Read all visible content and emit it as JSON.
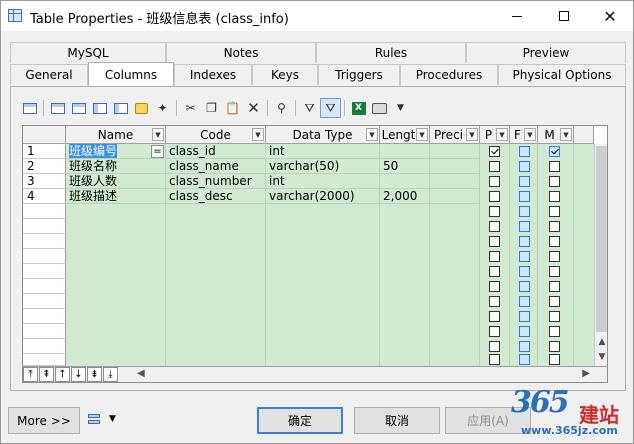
{
  "window": {
    "title": "Table Properties - 班级信息表 (class_info)"
  },
  "tabs_row_1": [
    {
      "label": "MySQL"
    },
    {
      "label": "Notes"
    },
    {
      "label": "Rules"
    },
    {
      "label": "Preview"
    }
  ],
  "tabs_row_2": [
    {
      "label": "General"
    },
    {
      "label": "Columns"
    },
    {
      "label": "Indexes"
    },
    {
      "label": "Keys"
    },
    {
      "label": "Triggers"
    },
    {
      "label": "Procedures"
    },
    {
      "label": "Physical Options"
    }
  ],
  "grid": {
    "headers": [
      "Name",
      "Code",
      "Data Type",
      "Lengt",
      "Preci",
      "P",
      "F",
      "M"
    ],
    "rows": [
      {
        "num": "1",
        "name": "班级编号",
        "code": "class_id",
        "type": "int",
        "length": "",
        "p": true,
        "m": true
      },
      {
        "num": "2",
        "name": "班级名称",
        "code": "class_name",
        "type": "varchar(50)",
        "length": "50",
        "p": false,
        "m": false
      },
      {
        "num": "3",
        "name": "班级人数",
        "code": "class_number",
        "type": "int",
        "length": "",
        "p": false,
        "m": false
      },
      {
        "num": "4",
        "name": "班级描述",
        "code": "class_desc",
        "type": "varchar(2000)",
        "length": "2,000",
        "p": false,
        "m": false
      }
    ],
    "edit_button": "="
  },
  "buttons": {
    "more": "More >>",
    "ok": "确定",
    "cancel": "取消",
    "apply": "应用(A)"
  },
  "watermark": {
    "brand": "365",
    "brand_cn": "建站",
    "url": "www.365jz.com"
  }
}
